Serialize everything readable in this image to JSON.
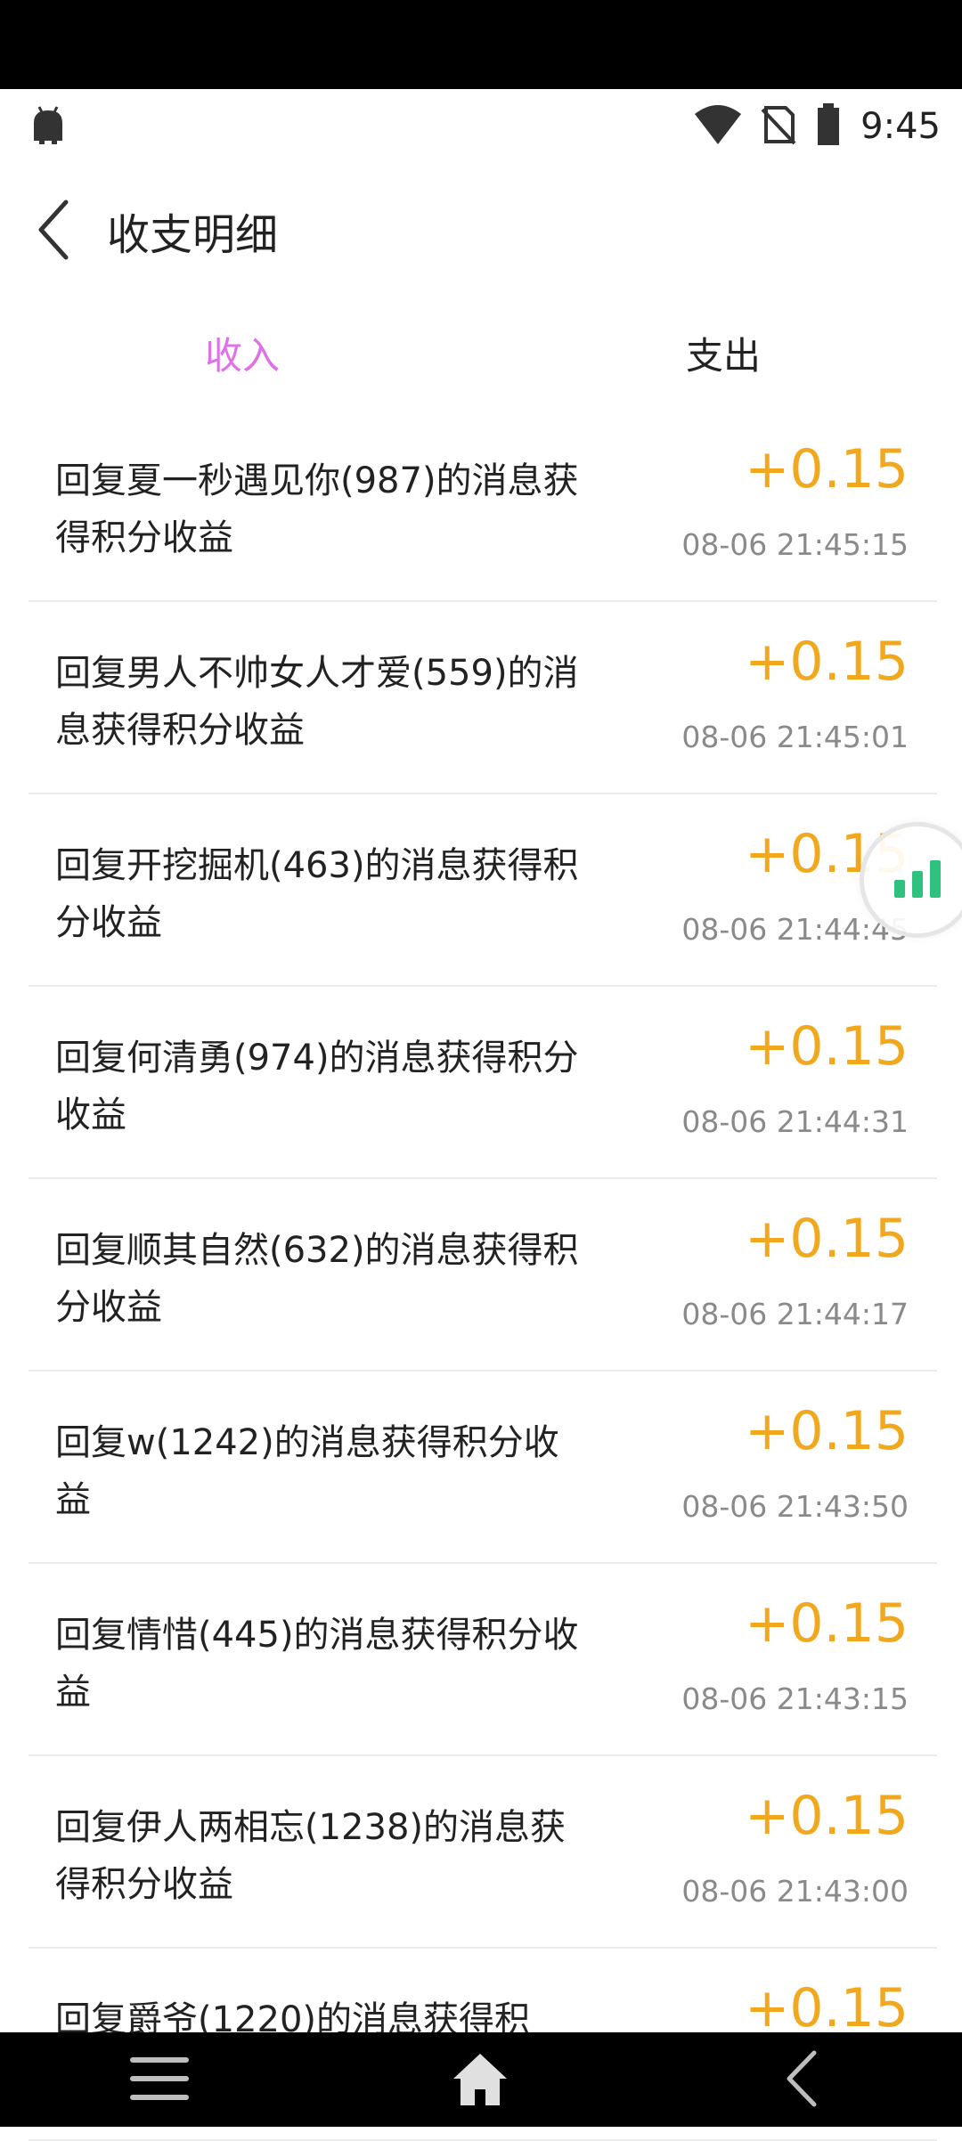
{
  "status": {
    "time": "9:45",
    "icons": [
      "android-icon",
      "wifi-icon",
      "no-sim-icon",
      "battery-icon"
    ]
  },
  "header": {
    "title": "收支明细",
    "back_icon": "chevron-left-icon"
  },
  "tabs": [
    {
      "label": "收入",
      "active": true
    },
    {
      "label": "支出",
      "active": false
    }
  ],
  "transactions": [
    {
      "desc": "回复夏一秒遇见你(987)的消息获得积分收益",
      "amount": "+0.15",
      "time": "08-06 21:45:15"
    },
    {
      "desc": "回复男人不帅女人才爱(559)的消息获得积分收益",
      "amount": "+0.15",
      "time": "08-06 21:45:01"
    },
    {
      "desc": "回复开挖掘机(463)的消息获得积分收益",
      "amount": "+0.15",
      "time": "08-06 21:44:45"
    },
    {
      "desc": "回复何清勇(974)的消息获得积分收益",
      "amount": "+0.15",
      "time": "08-06 21:44:31"
    },
    {
      "desc": "回复顺其自然(632)的消息获得积分收益",
      "amount": "+0.15",
      "time": "08-06 21:44:17"
    },
    {
      "desc": "回复w(1242)的消息获得积分收益",
      "amount": "+0.15",
      "time": "08-06 21:43:50"
    },
    {
      "desc": "回复情惜(445)的消息获得积分收益",
      "amount": "+0.15",
      "time": "08-06 21:43:15"
    },
    {
      "desc": "回复伊人两相忘(1238)的消息获得积分收益",
      "amount": "+0.15",
      "time": "08-06 21:43:00"
    },
    {
      "desc": "回复爵爷(1220)的消息获得积",
      "amount": "+0.15",
      "time": ""
    }
  ],
  "colors": {
    "active_tab": "#e070e8",
    "amount": "#f2a81d",
    "float_widget": "#2fc17f"
  },
  "nav": {
    "icons": [
      "menu-icon",
      "home-icon",
      "back-icon"
    ]
  }
}
